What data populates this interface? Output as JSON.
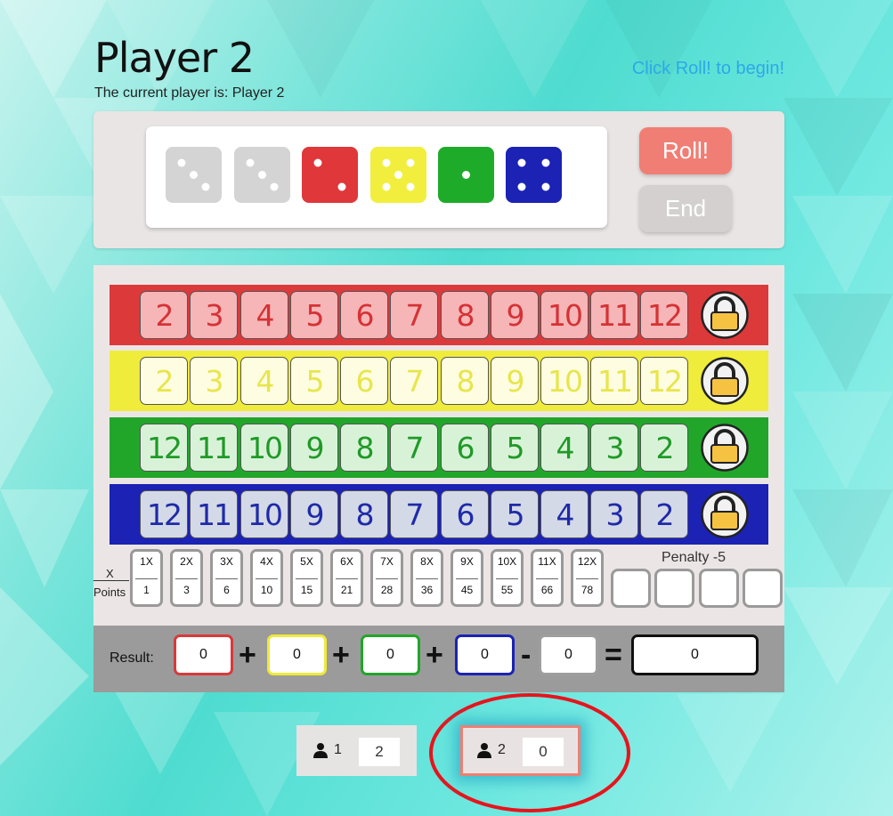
{
  "header": {
    "title": "Player 2",
    "current_player_text": "The current player is: Player 2",
    "hint": "Click Roll! to begin!"
  },
  "dice": [
    {
      "color": "white",
      "pips": 3,
      "fill": "#d4d4d4"
    },
    {
      "color": "white",
      "pips": 3,
      "fill": "#d4d4d4"
    },
    {
      "color": "red",
      "pips": 2,
      "fill": "#e0373a"
    },
    {
      "color": "yellow",
      "pips": 5,
      "fill": "#f2ee3e"
    },
    {
      "color": "green",
      "pips": 1,
      "fill": "#1fab2a"
    },
    {
      "color": "blue",
      "pips": 4,
      "fill": "#1b22b4"
    }
  ],
  "buttons": {
    "roll": "Roll!",
    "end": "End"
  },
  "rows": [
    {
      "color": "red",
      "bg": "#dc393b",
      "cell_bg": "#f6b5b7",
      "text": "#d53235",
      "numbers": [
        "2",
        "3",
        "4",
        "5",
        "6",
        "7",
        "8",
        "9",
        "10",
        "11",
        "12"
      ]
    },
    {
      "color": "yellow",
      "bg": "#f0ec3b",
      "cell_bg": "#fefde2",
      "text": "#e8e54c",
      "numbers": [
        "2",
        "3",
        "4",
        "5",
        "6",
        "7",
        "8",
        "9",
        "10",
        "11",
        "12"
      ]
    },
    {
      "color": "green",
      "bg": "#21a62a",
      "cell_bg": "#d8f2d8",
      "text": "#1f9a27",
      "numbers": [
        "12",
        "11",
        "10",
        "9",
        "8",
        "7",
        "6",
        "5",
        "4",
        "3",
        "2"
      ]
    },
    {
      "color": "blue",
      "bg": "#1b22b4",
      "cell_bg": "#d3d9e6",
      "text": "#1f2aa8",
      "numbers": [
        "12",
        "11",
        "10",
        "9",
        "8",
        "7",
        "6",
        "5",
        "4",
        "3",
        "2"
      ]
    }
  ],
  "multipliers": {
    "x_label": "X",
    "points_label": "Points",
    "items": [
      {
        "x": "1X",
        "points": "1"
      },
      {
        "x": "2X",
        "points": "3"
      },
      {
        "x": "3X",
        "points": "6"
      },
      {
        "x": "4X",
        "points": "10"
      },
      {
        "x": "5X",
        "points": "15"
      },
      {
        "x": "6X",
        "points": "21"
      },
      {
        "x": "7X",
        "points": "28"
      },
      {
        "x": "8X",
        "points": "36"
      },
      {
        "x": "9X",
        "points": "45"
      },
      {
        "x": "10X",
        "points": "55"
      },
      {
        "x": "11X",
        "points": "66"
      },
      {
        "x": "12X",
        "points": "78"
      }
    ]
  },
  "penalty": {
    "label": "Penalty -5"
  },
  "result": {
    "label": "Result:",
    "red": "0",
    "yellow": "0",
    "green": "0",
    "blue": "0",
    "penalty": "0",
    "total": "0",
    "plus": "+",
    "minus": "-",
    "equals": "="
  },
  "players": [
    {
      "number": "1",
      "score": "2",
      "active": false
    },
    {
      "number": "2",
      "score": "0",
      "active": true
    }
  ]
}
